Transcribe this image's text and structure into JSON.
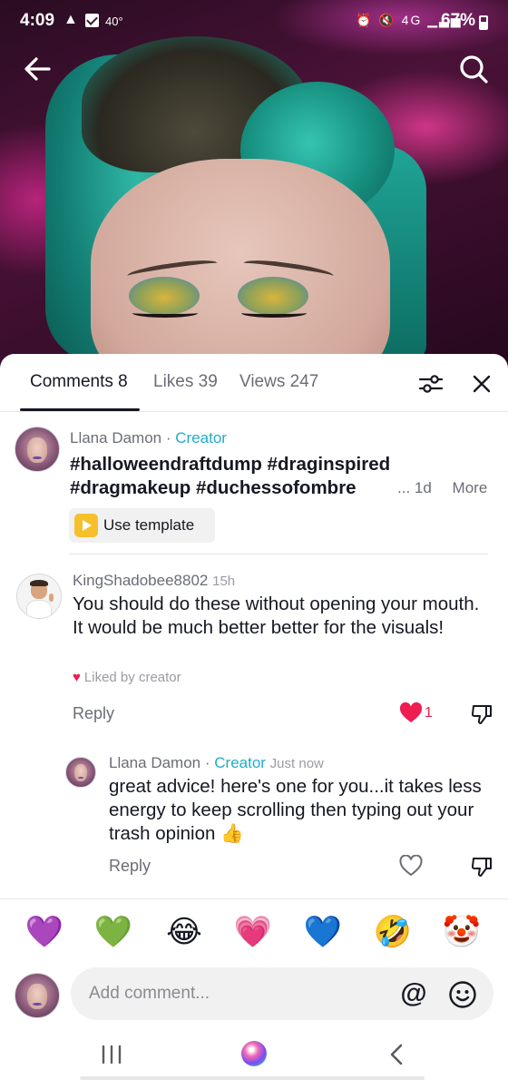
{
  "status_bar": {
    "time": "4:09",
    "temperature": "40°",
    "battery": "67%",
    "network": "4G"
  },
  "header": {
    "back_icon": "back-arrow-icon",
    "search_icon": "search-icon"
  },
  "tabs": [
    {
      "label": "Comments 8",
      "active": true
    },
    {
      "label": "Likes 39",
      "active": false
    },
    {
      "label": "Views 247",
      "active": false
    }
  ],
  "tab_actions": {
    "filter_icon": "sliders-icon",
    "close_icon": "close-icon"
  },
  "caption_post": {
    "author": "Llana Damon",
    "role": "Creator",
    "line1": "#halloweendraftdump #draginspired",
    "line2": "#dragmakeup #duchessofombre",
    "time": "... 1d",
    "more_label": "More",
    "template_label": "Use template"
  },
  "comments": [
    {
      "author": "KingShadobee8802",
      "time": "15h",
      "text": "You should do these without opening your mouth. It would be much better better for the visuals!",
      "liked_by": "Liked by creator",
      "reply_label": "Reply",
      "like_count": "1",
      "liked": true
    }
  ],
  "reply": {
    "author": "Llana Damon",
    "role": "Creator",
    "time": "Just now",
    "text": "great advice! here's one for you...it takes less energy to keep scrolling then typing out your trash opinion 👍",
    "reply_label": "Reply"
  },
  "quick_emojis": [
    "💜",
    "💚",
    "😂",
    "💗",
    "💙",
    "🤣",
    "🤡"
  ],
  "composer": {
    "placeholder": "Add comment...",
    "mention_symbol": "@"
  },
  "colors": {
    "accent_creator": "#1eaec9",
    "like_red": "#ee1d52",
    "text_primary": "#161823",
    "text_secondary": "#6b6d76"
  }
}
